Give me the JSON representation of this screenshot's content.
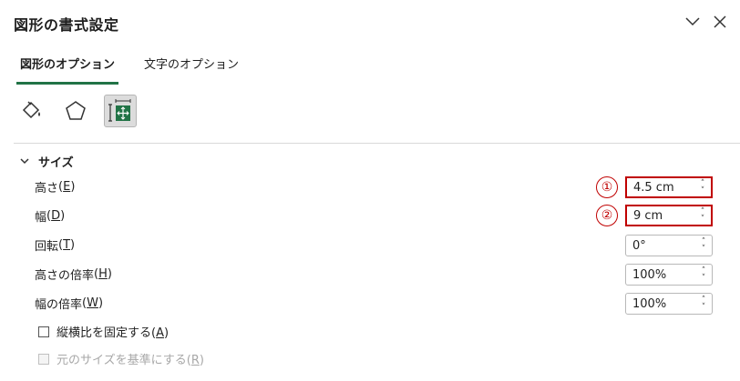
{
  "pane": {
    "title": "図形の書式設定"
  },
  "tabs": [
    {
      "label": "図形のオプション",
      "active": true
    },
    {
      "label": "文字のオプション",
      "active": false
    }
  ],
  "icon_tabs": [
    {
      "icon": "fill-line-icon"
    },
    {
      "icon": "effects-pentagon-icon"
    },
    {
      "icon": "size-properties-icon",
      "selected": true
    }
  ],
  "section": {
    "title": "サイズ"
  },
  "fields": [
    {
      "label": "高さ",
      "key": "E",
      "value": "4.5 cm",
      "marker": "①"
    },
    {
      "label": "幅",
      "key": "D",
      "value": "9 cm",
      "marker": "②"
    },
    {
      "label": "回転",
      "key": "T",
      "value": "0°"
    },
    {
      "label": "高さの倍率",
      "key": "H",
      "value": "100%"
    },
    {
      "label": "幅の倍率",
      "key": "W",
      "value": "100%"
    }
  ],
  "checkboxes": [
    {
      "label": "縦横比を固定する",
      "key": "A",
      "checked": false,
      "enabled": true
    },
    {
      "label": "元のサイズを基準にする",
      "key": "R",
      "checked": false,
      "enabled": false
    }
  ],
  "colors": {
    "accent": "#217346",
    "highlight": "#c00000"
  }
}
